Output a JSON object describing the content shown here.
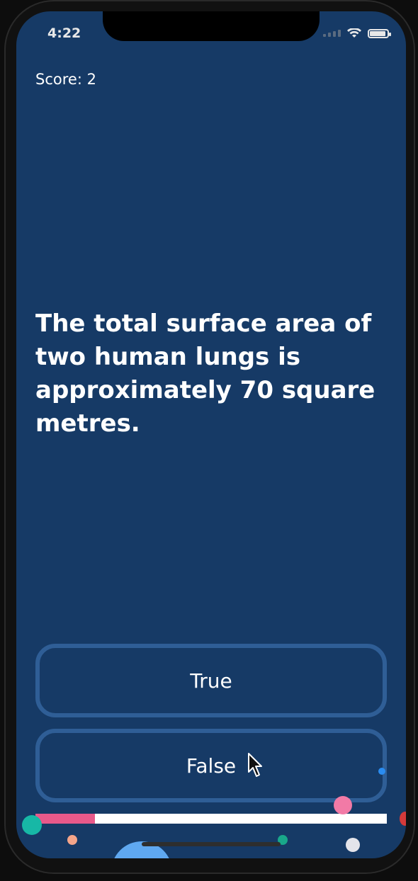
{
  "status_bar": {
    "time": "4:22"
  },
  "quiz": {
    "score_text": "Score: 2",
    "question": "The total surface area of two human lungs is approximately 70 square metres.",
    "answers": [
      {
        "label": "True"
      },
      {
        "label": "False"
      }
    ],
    "progress": 0.17
  },
  "colors": {
    "background": "#163a66",
    "button_border": "#2f5e96",
    "progress_fill": "#e8598a",
    "progress_track": "#ffffff"
  }
}
